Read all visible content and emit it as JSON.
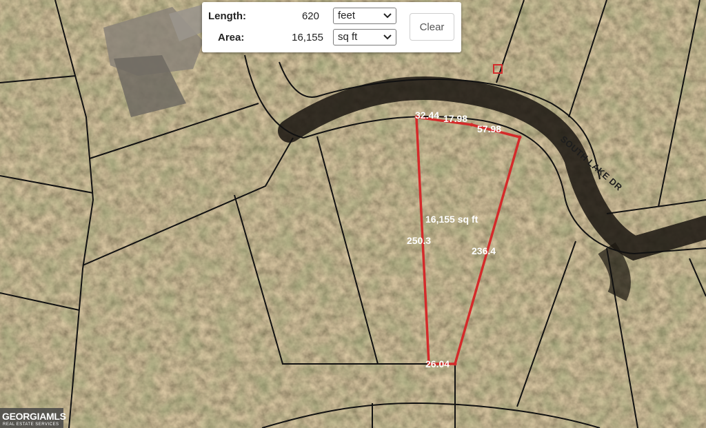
{
  "panel": {
    "length_label": "Length:",
    "length_value": "620",
    "length_unit": "feet",
    "area_label": "Area:",
    "area_value": "16,155",
    "area_unit": "sq ft",
    "clear_label": "Clear"
  },
  "map": {
    "street_label": "SOUTH LAKE DR",
    "area_label": "16,155 sq ft",
    "measurements": {
      "top_left": "32.44",
      "top_mid": "17.98",
      "top_right": "57.98",
      "left_side": "250.3",
      "right_side": "236.4",
      "bottom": "26.04"
    },
    "polygon_color": "#d42a2a",
    "parcel_line_color": "#111111"
  },
  "logo": {
    "name": "GEORGIAMLS",
    "tagline": "REAL ESTATE SERVICES"
  }
}
